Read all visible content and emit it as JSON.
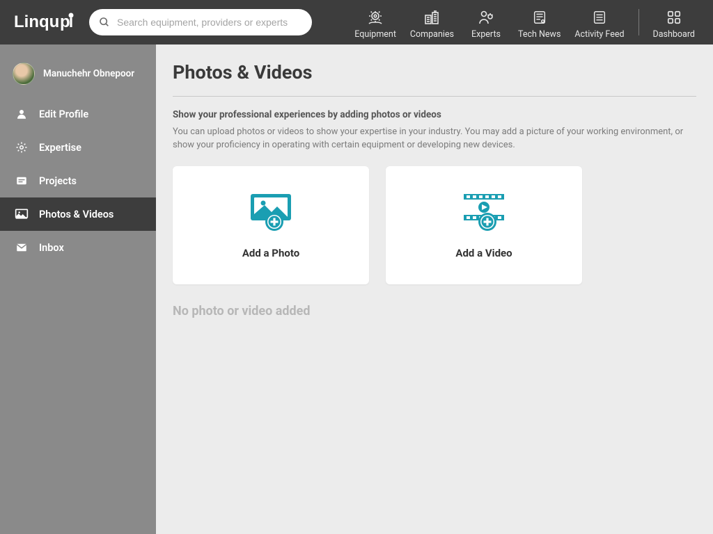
{
  "header": {
    "logo_text": "Linquip",
    "search_placeholder": "Search equipment, providers or experts",
    "nav": [
      {
        "label": "Equipment"
      },
      {
        "label": "Companies"
      },
      {
        "label": "Experts"
      },
      {
        "label": "Tech News"
      },
      {
        "label": "Activity Feed"
      }
    ],
    "dashboard_label": "Dashboard"
  },
  "sidebar": {
    "profile_name": "Manuchehr Obnepoor",
    "items": [
      {
        "label": "Edit Profile"
      },
      {
        "label": "Expertise"
      },
      {
        "label": "Projects"
      },
      {
        "label": "Photos & Videos"
      },
      {
        "label": "Inbox"
      }
    ]
  },
  "main": {
    "title": "Photos & Videos",
    "subhead": "Show your professional experiences by adding photos or videos",
    "description": "You can upload photos or videos to show your expertise in your industry. You may add a picture of your working environment, or show your proficiency in operating with certain equipment or developing new devices.",
    "add_photo_label": "Add a Photo",
    "add_video_label": "Add a Video",
    "empty_message": "No photo or video added"
  },
  "colors": {
    "accent": "#1a9eb2",
    "header_bg": "#3d3d3d",
    "sidebar_bg": "#8a8a8a"
  }
}
